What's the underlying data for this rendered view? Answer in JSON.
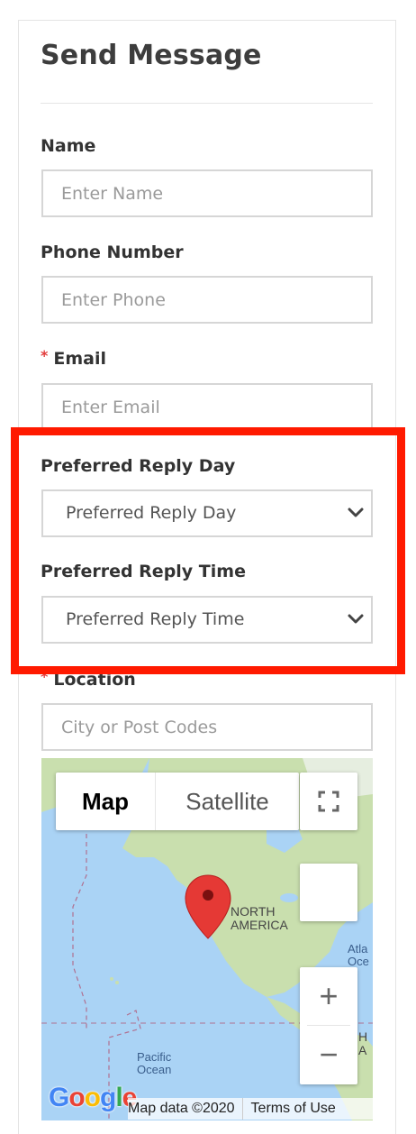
{
  "form": {
    "title": "Send Message",
    "fields": {
      "name": {
        "label": "Name",
        "placeholder": "Enter Name"
      },
      "phone": {
        "label": "Phone Number",
        "placeholder": "Enter Phone"
      },
      "email": {
        "label": "Email",
        "required_mark": "*",
        "placeholder": "Enter Email"
      },
      "reply_day": {
        "label": "Preferred Reply Day",
        "selected": "Preferred Reply Day"
      },
      "reply_time": {
        "label": "Preferred Reply Time",
        "selected": "Preferred Reply Time"
      },
      "location": {
        "label": "Location",
        "required_mark": "*",
        "placeholder": "City or Post Codes"
      }
    }
  },
  "map": {
    "type_buttons": {
      "map": "Map",
      "satellite": "Satellite"
    },
    "zoom": {
      "in": "+",
      "out": "−"
    },
    "labels": {
      "continent_line1": "NORTH",
      "continent_line2": "AMERICA",
      "ocean_line1": "Pacific",
      "ocean_line2": "Ocean",
      "atlantic_partial1": "Atla",
      "atlantic_partial2": "Oce",
      "partial_h": "H",
      "partial_a": "A"
    },
    "attribution": {
      "data": "Map data ©2020",
      "terms": "Terms of Use"
    },
    "logo_text": "Google",
    "marker_color": "#e53935"
  },
  "colors": {
    "highlight_border": "#ff1a00",
    "required": "#e23b3b",
    "water": "#aad3f5",
    "land": "#c9dfae"
  },
  "icons": {
    "select_arrow": "chevron-down-icon",
    "map_pin": "map-marker-icon",
    "fullscreen": "fullscreen-icon"
  }
}
